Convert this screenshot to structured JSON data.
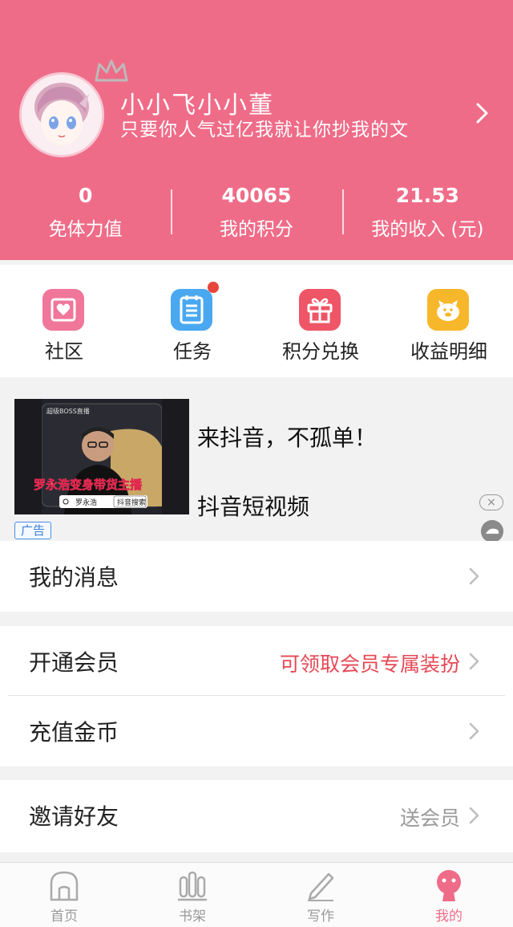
{
  "profile": {
    "name": "小小飞小小董",
    "signature": "只要你人气过亿我就让你抄我的文"
  },
  "stats": [
    {
      "value": "0",
      "label": "免体力值"
    },
    {
      "value": "40065",
      "label": "我的积分"
    },
    {
      "value": "21.53",
      "label": "我的收入 (元)"
    }
  ],
  "quick_menu": [
    {
      "label": "社区",
      "icon": "community-icon",
      "color": "#f0769a"
    },
    {
      "label": "任务",
      "icon": "task-icon",
      "color": "#4aa8f0",
      "badge": true
    },
    {
      "label": "积分兑换",
      "icon": "gift-icon",
      "color": "#ee5566"
    },
    {
      "label": "收益明细",
      "icon": "piggy-bank-icon",
      "color": "#f7b72a"
    }
  ],
  "ad": {
    "title": "来抖音，不孤单！",
    "subtitle": "抖音短视频",
    "tag": "广告",
    "close": "×",
    "thumb_caption": "罗永浩变身带货主播",
    "thumb_search_name": "罗永浩",
    "thumb_search_button": "抖音搜索",
    "thumb_top_text": "超级BOSS直播"
  },
  "rows": {
    "messages": {
      "label": "我的消息"
    },
    "vip": {
      "label": "开通会员",
      "extra": "可领取会员专属装扮",
      "extra_color": "#e64855"
    },
    "recharge": {
      "label": "充值金币"
    },
    "invite": {
      "label": "邀请好友",
      "extra": "送会员",
      "extra_color": "#999999"
    }
  },
  "tabbar": [
    {
      "label": "首页",
      "icon": "home-icon"
    },
    {
      "label": "书架",
      "icon": "bookshelf-icon"
    },
    {
      "label": "写作",
      "icon": "pen-icon"
    },
    {
      "label": "我的",
      "icon": "profile-icon",
      "active": true
    }
  ],
  "colors": {
    "brand": "#ef6c88",
    "badge": "#e8453c"
  }
}
